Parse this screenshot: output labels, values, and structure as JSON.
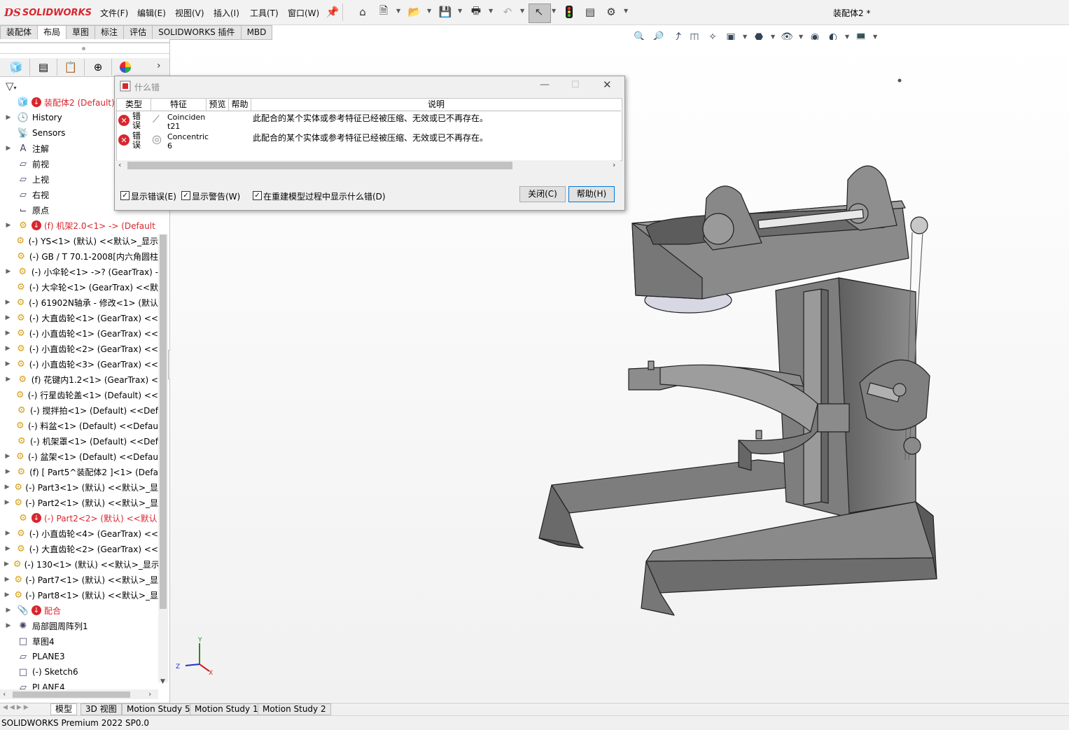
{
  "app": {
    "logo_ds": "DS",
    "logo_text": "SOLIDWORKS",
    "doc_title": "装配体2 *"
  },
  "menu": [
    "文件(F)",
    "编辑(E)",
    "视图(V)",
    "插入(I)",
    "工具(T)",
    "窗口(W)"
  ],
  "command_tabs": [
    "装配体",
    "布局",
    "草图",
    "标注",
    "评估",
    "SOLIDWORKS 插件",
    "MBD"
  ],
  "active_command_tab": "布局",
  "tree": [
    {
      "text": "装配体2 (Default) <D",
      "red": true,
      "err": true,
      "exp": false
    },
    {
      "text": "History",
      "exp": true
    },
    {
      "text": "Sensors",
      "exp": false
    },
    {
      "text": "注解",
      "exp": true
    },
    {
      "text": "前视",
      "exp": false
    },
    {
      "text": "上视",
      "exp": false
    },
    {
      "text": "右视",
      "exp": false
    },
    {
      "text": "原点",
      "exp": false
    },
    {
      "text": "(f) 机架2.0<1> -> (Default",
      "red": true,
      "err": true,
      "exp": true
    },
    {
      "text": "(-) YS<1> (默认) <<默认>_显示",
      "exp": false
    },
    {
      "text": "(-) GB / T 70.1-2008[内六角圆柱",
      "exp": false
    },
    {
      "text": "(-) 小伞轮<1> ->? (GearTrax) -",
      "exp": true
    },
    {
      "text": "(-) 大伞轮<1> (GearTrax) <<默",
      "exp": false
    },
    {
      "text": "(-) 61902N轴承 - 修改<1> (默认",
      "exp": true
    },
    {
      "text": "(-) 大直齿轮<1> (GearTrax) <<",
      "exp": true
    },
    {
      "text": "(-) 小直齿轮<1> (GearTrax) <<",
      "exp": true
    },
    {
      "text": "(-) 小直齿轮<2> (GearTrax) <<",
      "exp": true
    },
    {
      "text": "(-) 小直齿轮<3> (GearTrax) <<",
      "exp": true
    },
    {
      "text": "(f) 花键内1.2<1> (GearTrax) <",
      "exp": true
    },
    {
      "text": "(-) 行星齿轮盖<1> (Default) <<",
      "exp": false
    },
    {
      "text": "(-) 搅拌拍<1> (Default) <<Def",
      "exp": false
    },
    {
      "text": "(-) 料盆<1> (Default) <<Defau",
      "exp": false
    },
    {
      "text": "(-) 机架罩<1> (Default) <<Def",
      "exp": false
    },
    {
      "text": "(-) 盆架<1> (Default) <<Defau",
      "exp": true
    },
    {
      "text": "(f) [ Part5^装配体2 ]<1> (Defa",
      "exp": true
    },
    {
      "text": "(-) Part3<1> (默认) <<默认>_显",
      "exp": true
    },
    {
      "text": "(-) Part2<1> (默认) <<默认>_显",
      "exp": true
    },
    {
      "text": "(-) Part2<2> (默认) <<默认",
      "red": true,
      "err": true,
      "exp": false
    },
    {
      "text": "(-) 小直齿轮<4> (GearTrax) <<",
      "exp": true
    },
    {
      "text": "(-) 大直齿轮<2> (GearTrax) <<",
      "exp": true
    },
    {
      "text": "(-) 130<1> (默认) <<默认>_显示",
      "exp": true
    },
    {
      "text": "(-) Part7<1> (默认) <<默认>_显",
      "exp": true
    },
    {
      "text": "(-) Part8<1> (默认) <<默认>_显",
      "exp": true
    },
    {
      "text": "配合",
      "red": true,
      "err": true,
      "exp": true
    },
    {
      "text": "局部圆周阵列1",
      "exp": true
    },
    {
      "text": "草图4",
      "exp": false
    },
    {
      "text": "PLANE3",
      "exp": false
    },
    {
      "text": "(-) Sketch6",
      "exp": false
    },
    {
      "text": "PLANE4",
      "exp": false
    }
  ],
  "dialog": {
    "title": "什么错",
    "columns": [
      "类型",
      "特征",
      "预览",
      "帮助",
      "说明"
    ],
    "rows": [
      {
        "type": "错误",
        "feature": "Coincident21",
        "feature_l1": "Coinciden",
        "feature_l2": "t21",
        "desc": "此配合的某个实体或参考特征已经被压缩、无效或已不再存在。"
      },
      {
        "type": "错误",
        "feature": "Concentric6",
        "feature_l1": "Concentric",
        "feature_l2": "6",
        "desc": "此配合的某个实体或参考特征已经被压缩、无效或已不再存在。"
      }
    ],
    "checkboxes": [
      {
        "label": "显示错误(E)",
        "checked": true
      },
      {
        "label": "显示警告(W)",
        "checked": true
      },
      {
        "label": "在重建模型过程中显示什么错(D)",
        "checked": true
      }
    ],
    "close_label": "关闭(C)",
    "help_label": "帮助(H)"
  },
  "triad": {
    "x": "X",
    "y": "Y",
    "z": "Z"
  },
  "bottom_tabs": [
    "模型",
    "3D 视图",
    "Motion Study 5",
    "Motion Study 1",
    "Motion Study 2"
  ],
  "status": "SOLIDWORKS Premium 2022 SP0.0",
  "colors": {
    "brand": "#d8262e",
    "error": "#d8262e",
    "model_grey": "#7a7a7a"
  }
}
